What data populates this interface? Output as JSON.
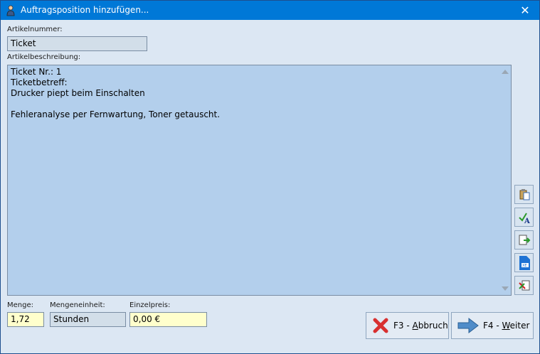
{
  "window": {
    "title": "Auftragsposition hinzufügen...",
    "close_glyph": "✕"
  },
  "artikelnummer": {
    "label": "Artikelnummer:",
    "value": "Ticket"
  },
  "artikelbeschreibung": {
    "label": "Artikelbeschreibung:",
    "text": "Ticket Nr.: 1\nTicketbetreff:\nDrucker piept beim Einschalten\n\nFehleranalyse per Fernwartung, Toner getauscht."
  },
  "menge": {
    "label": "Menge:",
    "value": "1,72"
  },
  "mengeneinheit": {
    "label": "Mengeneinheit:",
    "value": "Stunden"
  },
  "einzelpreis": {
    "label": "Einzelpreis:",
    "value": "0,00 €"
  },
  "buttons": {
    "cancel": {
      "prefix": "F3 - ",
      "accel": "A",
      "rest": "bbruch"
    },
    "next": {
      "prefix": "F4 - ",
      "accel": "W",
      "rest": "eiter"
    }
  },
  "tools": [
    "paste-icon",
    "spellcheck-icon",
    "insert-icon",
    "export-icon",
    "replace-icon"
  ],
  "colors": {
    "titlebar": "#0078d7",
    "dialog_bg": "#dce7f3",
    "memo_bg": "#b3cfec",
    "input_yellow": "#ffffcc"
  }
}
